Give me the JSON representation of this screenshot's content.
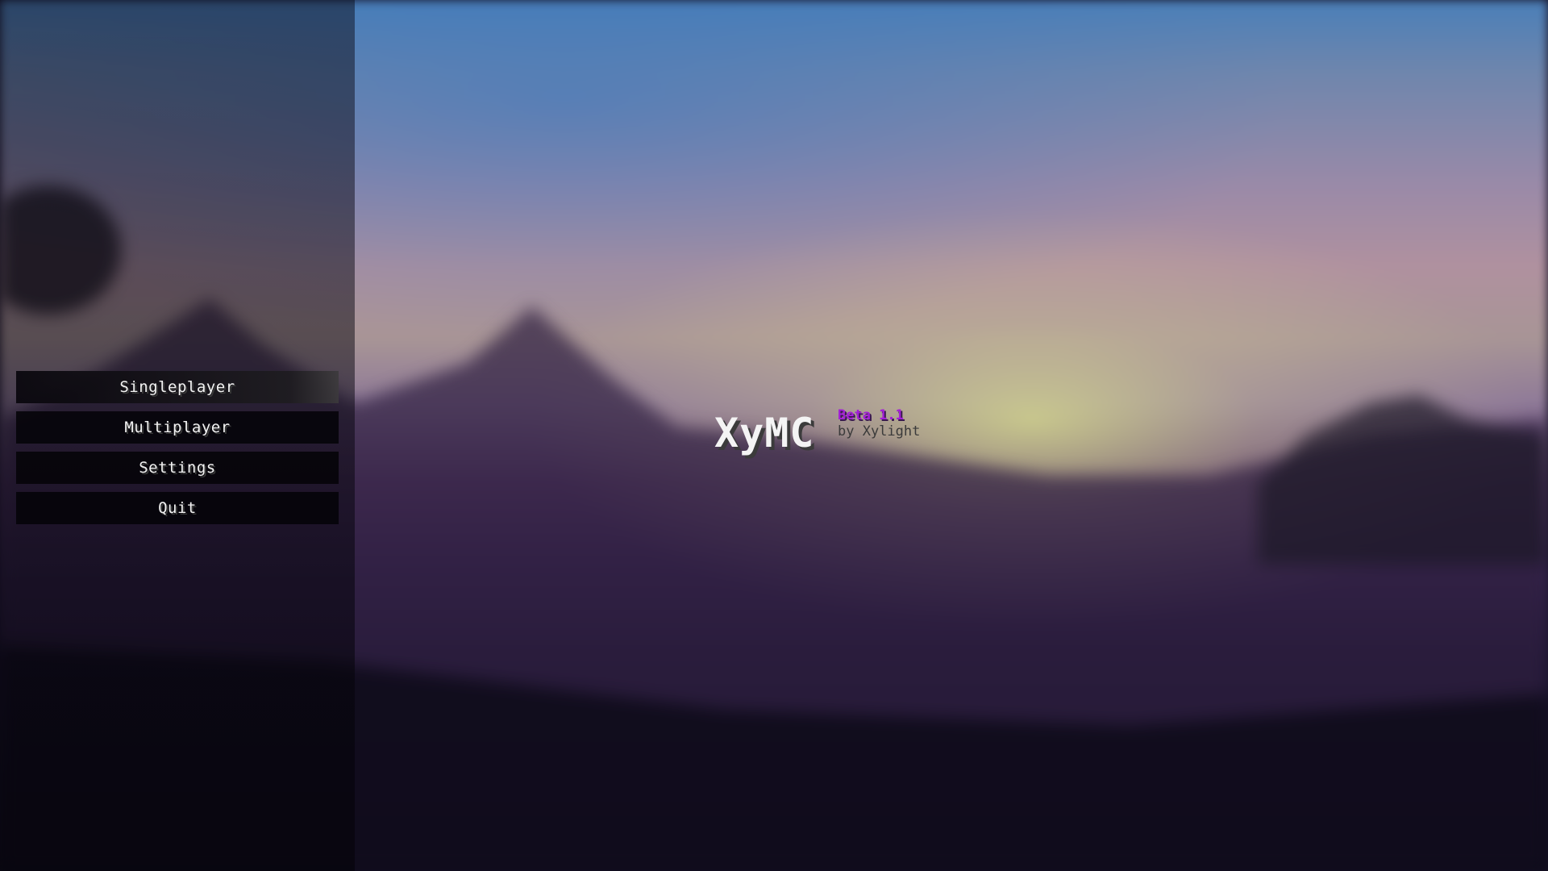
{
  "menu": {
    "items": [
      {
        "label": "Singleplayer"
      },
      {
        "label": "Multiplayer"
      },
      {
        "label": "Settings"
      },
      {
        "label": "Quit"
      }
    ]
  },
  "logo": {
    "title": "XyMC",
    "version": "Beta 1.1",
    "author": "by Xylight"
  },
  "colors": {
    "version_text": "#a21fd6",
    "button_background": "#050408",
    "button_text": "#f2f2f2"
  }
}
